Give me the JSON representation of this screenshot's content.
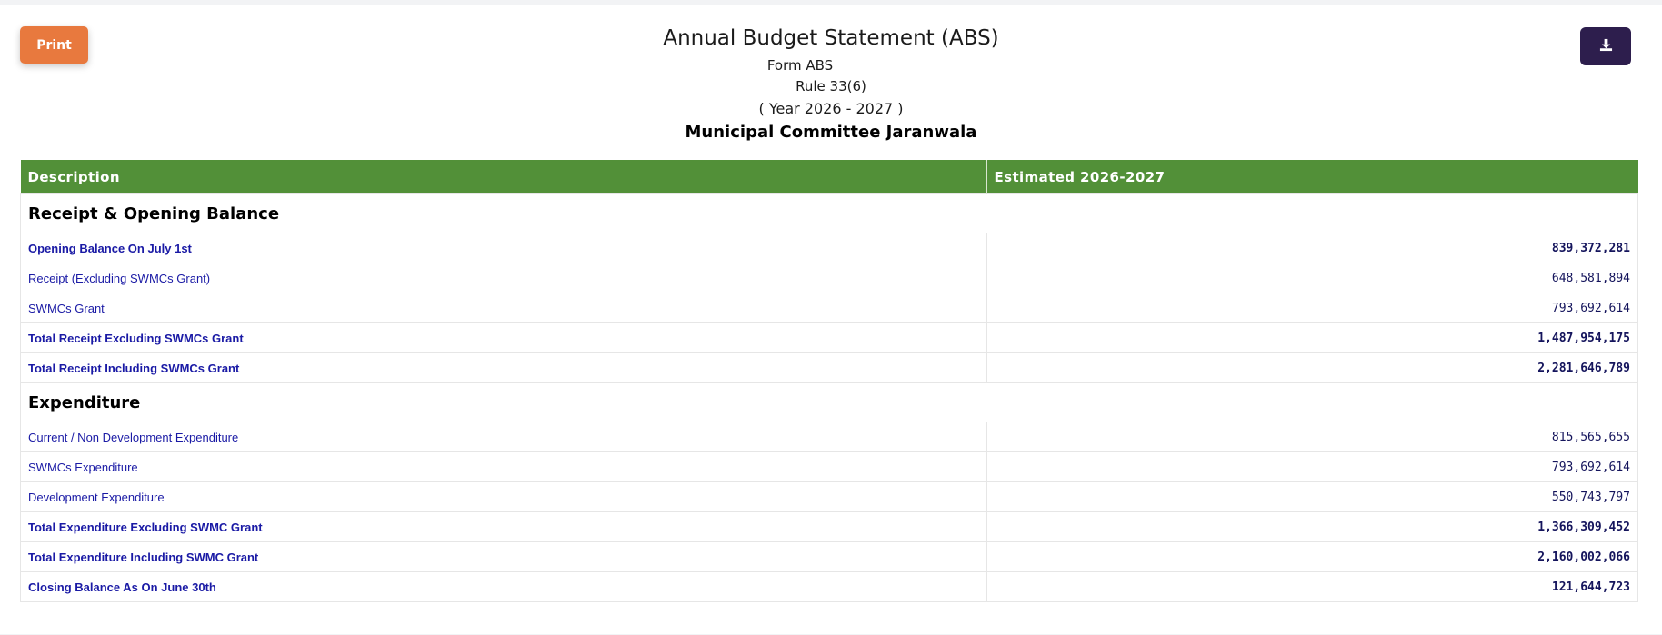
{
  "toolbar": {
    "print_label": "Print",
    "download_icon": "download-icon"
  },
  "header": {
    "title": "Annual Budget Statement (ABS)",
    "form": "Form ABS",
    "rule": "Rule 33(6)",
    "year": "( Year 2026 - 2027 )",
    "organization": "Municipal Committee Jaranwala"
  },
  "colors": {
    "print_button": "#e8793e",
    "download_button": "#2d1e4d",
    "table_header": "#529038",
    "row_text": "#1a1aa5"
  },
  "table": {
    "columns": [
      "Description",
      "Estimated 2026-2027"
    ],
    "sections": [
      {
        "heading": "Receipt & Opening Balance",
        "rows": [
          {
            "label": "Opening Balance On July 1st",
            "value": "839,372,281",
            "bold": true
          },
          {
            "label": "Receipt (Excluding SWMCs Grant)",
            "value": "648,581,894",
            "bold": false
          },
          {
            "label": "SWMCs Grant",
            "value": "793,692,614",
            "bold": false
          },
          {
            "label": "Total Receipt Excluding SWMCs Grant",
            "value": "1,487,954,175",
            "bold": true
          },
          {
            "label": "Total Receipt Including SWMCs Grant",
            "value": "2,281,646,789",
            "bold": true
          }
        ]
      },
      {
        "heading": "Expenditure",
        "rows": [
          {
            "label": "Current / Non Development Expenditure",
            "value": "815,565,655",
            "bold": false
          },
          {
            "label": "SWMCs Expenditure",
            "value": "793,692,614",
            "bold": false
          },
          {
            "label": "Development Expenditure",
            "value": "550,743,797",
            "bold": false
          },
          {
            "label": "Total Expenditure Excluding SWMC Grant",
            "value": "1,366,309,452",
            "bold": true
          },
          {
            "label": "Total Expenditure Including SWMC Grant",
            "value": "2,160,002,066",
            "bold": true
          },
          {
            "label": "Closing Balance As On June 30th",
            "value": "121,644,723",
            "bold": true
          }
        ]
      }
    ]
  }
}
